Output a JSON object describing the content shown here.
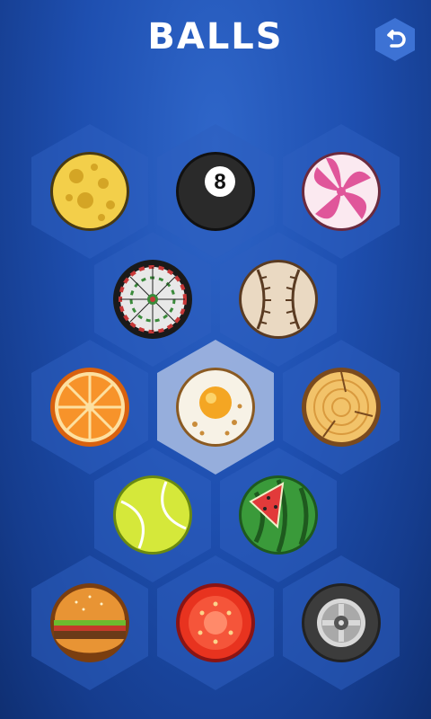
{
  "header": {
    "title": "BALLS",
    "back_icon": "undo-arrow-icon"
  },
  "colors": {
    "bg": "#1e4fb0",
    "hex_tile": "#2d5fc0",
    "hex_selected": "#9db3de"
  },
  "balls": [
    {
      "name": "cheese",
      "selected": false
    },
    {
      "name": "8-ball",
      "selected": false,
      "label": "8"
    },
    {
      "name": "candy",
      "selected": false
    },
    {
      "name": "dartboard",
      "selected": false
    },
    {
      "name": "baseball",
      "selected": false
    },
    {
      "name": "orange",
      "selected": false
    },
    {
      "name": "fried-egg",
      "selected": true
    },
    {
      "name": "wood-log",
      "selected": false
    },
    {
      "name": "tennis-ball",
      "selected": false
    },
    {
      "name": "watermelon",
      "selected": false
    },
    {
      "name": "burger",
      "selected": false
    },
    {
      "name": "tomato",
      "selected": false
    },
    {
      "name": "tire",
      "selected": false
    }
  ]
}
